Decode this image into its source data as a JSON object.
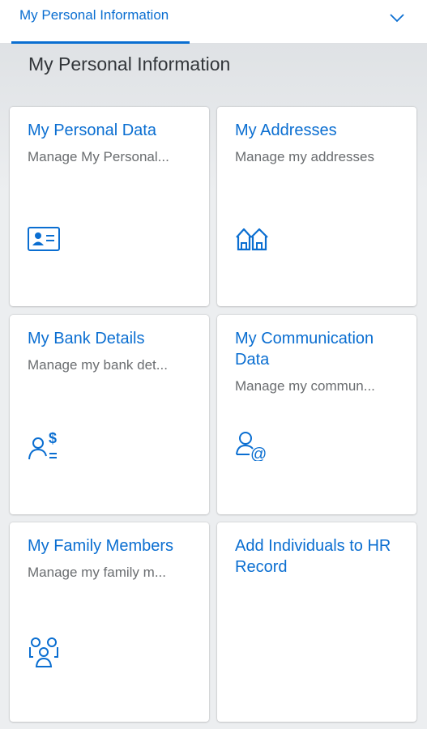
{
  "tabs": [
    {
      "label": "My Personal Information",
      "selected": true
    }
  ],
  "section": {
    "title": "My Personal Information"
  },
  "tiles": [
    {
      "title": "My Personal Data",
      "subtitle": "Manage My Personal...",
      "icon": "person-card-icon"
    },
    {
      "title": "My Addresses",
      "subtitle": "Manage my addresses",
      "icon": "houses-icon"
    },
    {
      "title": "My Bank Details",
      "subtitle": "Manage my bank det...",
      "icon": "person-dollar-icon"
    },
    {
      "title": "My Communication Data",
      "subtitle": "Manage my commun...",
      "icon": "person-at-icon"
    },
    {
      "title": "My Family Members",
      "subtitle": "Manage my family m...",
      "icon": "family-icon"
    },
    {
      "title": "Add Individuals to HR Record",
      "subtitle": "",
      "icon": ""
    }
  ],
  "colors": {
    "accent": "#0a6ed1",
    "tile_bg": "#ffffff",
    "page_bg": "#eceef0",
    "subtitle": "#6a6d70",
    "title_text": "#32363a"
  }
}
